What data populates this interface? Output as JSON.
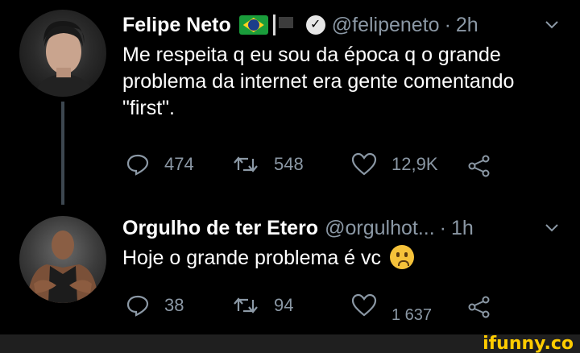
{
  "tweets": [
    {
      "author_name": "Felipe Neto",
      "handle": "@felipeneto",
      "dot": "·",
      "time": "2h",
      "text": "Me respeita q eu sou da época q o grande problema da internet era gente comentando \"first\".",
      "replies": "474",
      "retweets": "548",
      "likes": "12,9K"
    },
    {
      "author_name": "Orgulho de ter Etero",
      "handle": "@orgulhot...",
      "dot": "·",
      "time": "1h",
      "text": "Hoje o grande problema é vc",
      "replies": "38",
      "retweets": "94",
      "likes": "1 637"
    }
  ],
  "watermark": "ifunny.co",
  "colors": {
    "background": "#000000",
    "text_primary": "#ffffff",
    "text_secondary": "#8b98a5",
    "watermark": "#ffcc00"
  },
  "icons": [
    "verified-icon",
    "brazil-flag-icon",
    "black-flag-icon",
    "chevron-down-icon",
    "reply-icon",
    "retweet-icon",
    "like-icon",
    "share-icon",
    "worried-face-emoji"
  ]
}
